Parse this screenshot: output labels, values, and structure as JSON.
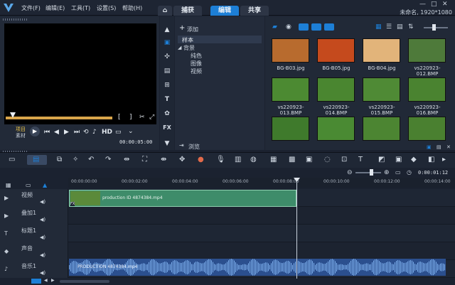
{
  "menu": [
    "文件(F)",
    "编辑(E)",
    "工具(T)",
    "设置(S)",
    "帮助(H)"
  ],
  "tabs": {
    "home": "⌂",
    "capture": "捕获",
    "edit": "编辑",
    "share": "共享"
  },
  "project_info": "未命名, 1920*1080",
  "window_controls": {
    "min": "—",
    "max": "□",
    "close": "✕"
  },
  "preview": {
    "mode_project": "项目",
    "mode_clip": "素材",
    "hd": "HD",
    "timecode": "00:00:05:00",
    "bracket_in": "[",
    "bracket_out": "]"
  },
  "library": {
    "add": "添加",
    "folders": [
      {
        "label": "样本",
        "selected": true,
        "level": 0
      },
      {
        "label": "背景",
        "selected": false,
        "level": 0
      },
      {
        "label": "纯色",
        "selected": false,
        "level": 1
      },
      {
        "label": "图像",
        "selected": false,
        "level": 1
      },
      {
        "label": "视频",
        "selected": false,
        "level": 1
      }
    ],
    "browse": "浏览",
    "side_icons": [
      "media-icon",
      "transition-icon",
      "title-icon",
      "graphic-icon",
      "T",
      "filter-icon",
      "FX"
    ],
    "assets": [
      {
        "name": "BG-B03.jpg",
        "color": "#b86b2e"
      },
      {
        "name": "BG-B05.jpg",
        "color": "#c54a1d"
      },
      {
        "name": "BG-B04.jpg",
        "color": "#e2b47a"
      },
      {
        "name": "vs220923-012.BMP",
        "color": "#4e7a3a"
      },
      {
        "name": "vs220923-013.BMP",
        "color": "#4c8a32"
      },
      {
        "name": "vs220923-014.BMP",
        "color": "#4a8630"
      },
      {
        "name": "vs220923-015.BMP",
        "color": "#4f8a35"
      },
      {
        "name": "vs220923-016.BMP",
        "color": "#4a8330"
      },
      {
        "name": "",
        "color": "#3f7a2c"
      },
      {
        "name": "",
        "color": "#4a8a33"
      },
      {
        "name": "",
        "color": "#4c8532"
      },
      {
        "name": "",
        "color": "#4a8030"
      }
    ]
  },
  "timeline": {
    "ruler_labels": [
      "00:00:00:00",
      "00:00:02:00",
      "00:00:04:00",
      "00:00:06:00",
      "00:00:08:00",
      "00:00:10:00",
      "00:00:12:00",
      "00:00:14:00"
    ],
    "zoom_time": "0:00:01:12",
    "tracks": [
      {
        "name": "视频",
        "type": "video"
      },
      {
        "name": "叠加1",
        "type": "overlay"
      },
      {
        "name": "标题1",
        "type": "title"
      },
      {
        "name": "声音",
        "type": "voice"
      },
      {
        "name": "音乐1",
        "type": "music"
      }
    ],
    "video_clip": "production ID 4874384.mp4",
    "music_clip": "PRODUCTION 4874384.mp4",
    "fx_badge": "FX"
  },
  "colors": {
    "accent": "#1d7fd6",
    "clip_video": "#3e8c6a",
    "clip_audio": "#3a7bd5"
  }
}
